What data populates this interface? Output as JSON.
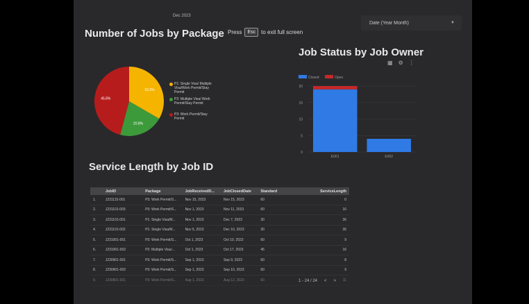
{
  "header": {
    "month": "Dec 2023"
  },
  "filter": {
    "label": "Date (Year Month)"
  },
  "banner": {
    "pre": "Press",
    "key": "Esc",
    "post": "to exit full screen"
  },
  "titles": {
    "jobs_by_package": "Number of Jobs by Package",
    "job_status": "Job Status by Job Owner",
    "service_length": "Service Length by Job ID"
  },
  "pie": {
    "legend": [
      {
        "label": "P1: Single Visa/ Multiple Visa/Work Permit/Stay Permit",
        "color": "#f5b400"
      },
      {
        "label": "P2: Multiple Visa/ Work Permit/Stay Permit",
        "color": "#3c9a3a"
      },
      {
        "label": "P3: Work Permit/Stay Permit",
        "color": "#b71c1c"
      }
    ]
  },
  "chart_data": [
    {
      "type": "pie",
      "title": "Number of Jobs by Package",
      "categories": [
        "P1: Single Visa/ Multiple Visa/Work Permit/Stay Permit",
        "P2: Multiple Visa/ Work Permit/Stay Permit",
        "P3: Work Permit/Stay Permit"
      ],
      "values": [
        33.3,
        20.8,
        45.8
      ],
      "labels": [
        "33.3%",
        "20.8%",
        "45.8%"
      ]
    },
    {
      "type": "bar",
      "title": "Job Status by Job Owner",
      "categories": [
        "E001",
        "E002"
      ],
      "series": [
        {
          "name": "Closed",
          "values": [
            19,
            4
          ],
          "color": "#2f7ae5"
        },
        {
          "name": "Open",
          "values": [
            1,
            0
          ],
          "color": "#c62828"
        }
      ],
      "ylim": [
        0,
        20
      ],
      "yticks": [
        "0",
        "5",
        "10",
        "15",
        "20"
      ],
      "legend": "top-left",
      "stacked": true
    }
  ],
  "table": {
    "columns": [
      "",
      "JobID",
      "Package",
      "JobReceivedD...",
      "JobClosedDate",
      "Standard",
      "ServiceLength"
    ],
    "rows": [
      [
        "1.",
        "J231115-001",
        "P3: Work Permit/S...",
        "Nov 15, 2023",
        "Nov 15, 2023",
        "60",
        "0"
      ],
      [
        "2.",
        "J231101-003",
        "P3: Work Permit/S...",
        "Nov 1, 2023",
        "Nov 11, 2023",
        "60",
        "10"
      ],
      [
        "3.",
        "J231101-001",
        "P1: Single Visa/M...",
        "Nov 1, 2023",
        "Dec 7, 2023",
        "30",
        "36"
      ],
      [
        "4.",
        "J231101-002",
        "P1: Single Visa/M...",
        "Nov 5, 2023",
        "Dec 10, 2023",
        "30",
        "35"
      ],
      [
        "5.",
        "J231001-001",
        "P3: Work Permit/S...",
        "Oct 1, 2023",
        "Oct 10, 2023",
        "60",
        "9"
      ],
      [
        "6.",
        "J231001-002",
        "P2: Multiple Visa/...",
        "Oct 1, 2023",
        "Oct 17, 2023",
        "45",
        "16"
      ],
      [
        "7.",
        "J230901-001",
        "P3: Work Permit/S...",
        "Sep 1, 2023",
        "Sep 9, 2023",
        "60",
        "8"
      ],
      [
        "8.",
        "J230901-002",
        "P3: Work Permit/S...",
        "Sep 1, 2023",
        "Sep 10, 2023",
        "60",
        "9"
      ],
      [
        "9.",
        "J230801-001",
        "P3: Work Permit/S...",
        "Aug 1, 2023",
        "Aug 12, 2023",
        "60",
        "11"
      ]
    ]
  },
  "pager": {
    "range": "1 - 24 / 24",
    "prev": "<",
    "next": ">"
  }
}
